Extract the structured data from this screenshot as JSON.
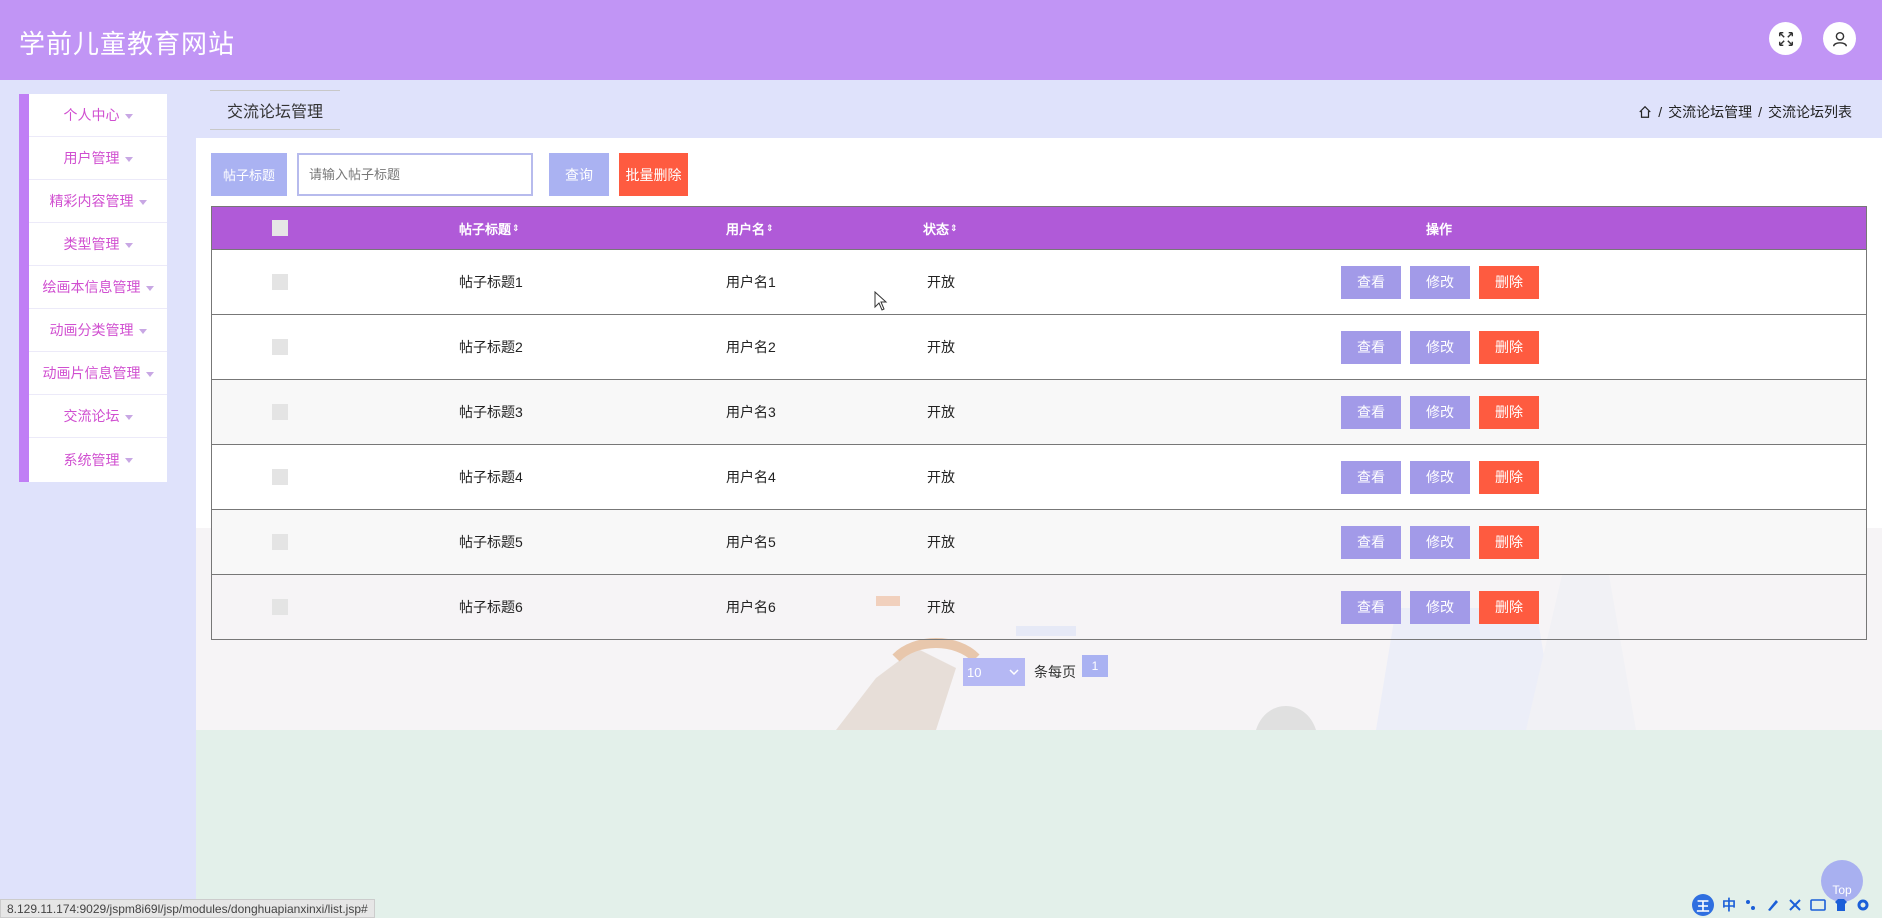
{
  "header": {
    "site_title": "学前儿童教育网站"
  },
  "sidebar": {
    "items": [
      {
        "label": "个人中心"
      },
      {
        "label": "用户管理"
      },
      {
        "label": "精彩内容管理"
      },
      {
        "label": "类型管理"
      },
      {
        "label": "绘画本信息管理"
      },
      {
        "label": "动画分类管理"
      },
      {
        "label": "动画片信息管理"
      },
      {
        "label": "交流论坛"
      },
      {
        "label": "系统管理"
      }
    ]
  },
  "tab": {
    "label": "交流论坛管理"
  },
  "breadcrumb": {
    "level1": "交流论坛管理",
    "level2": "交流论坛列表",
    "separator": "/"
  },
  "search": {
    "label": "帖子标题",
    "placeholder": "请输入帖子标题",
    "query_button": "查询",
    "batch_delete_button": "批量删除"
  },
  "table": {
    "columns": {
      "title": "帖子标题",
      "username": "用户名",
      "status": "状态",
      "actions": "操作",
      "sort_icon": "⇕"
    },
    "rows": [
      {
        "title": "帖子标题1",
        "username": "用户名1",
        "status": "开放"
      },
      {
        "title": "帖子标题2",
        "username": "用户名2",
        "status": "开放"
      },
      {
        "title": "帖子标题3",
        "username": "用户名3",
        "status": "开放"
      },
      {
        "title": "帖子标题4",
        "username": "用户名4",
        "status": "开放"
      },
      {
        "title": "帖子标题5",
        "username": "用户名5",
        "status": "开放"
      },
      {
        "title": "帖子标题6",
        "username": "用户名6",
        "status": "开放"
      }
    ],
    "row_actions": {
      "view": "查看",
      "edit": "修改",
      "delete": "删除"
    }
  },
  "pagination": {
    "page_size": "10",
    "per_page_label": "条每页",
    "current_page": "1"
  },
  "statusbar": {
    "url": "8.129.11.174:9029/jspm8i69l/jsp/modules/donghuapianxinxi/list.jsp#"
  },
  "top_button": {
    "label": "Top"
  },
  "ime": {
    "logo": "王",
    "mode": "中"
  },
  "colors": {
    "header": "#c195f5",
    "table_header": "#b05ad8",
    "danger": "#fe5b40",
    "accent": "#aab2f2",
    "sidebar_text": "#d04fd0"
  }
}
